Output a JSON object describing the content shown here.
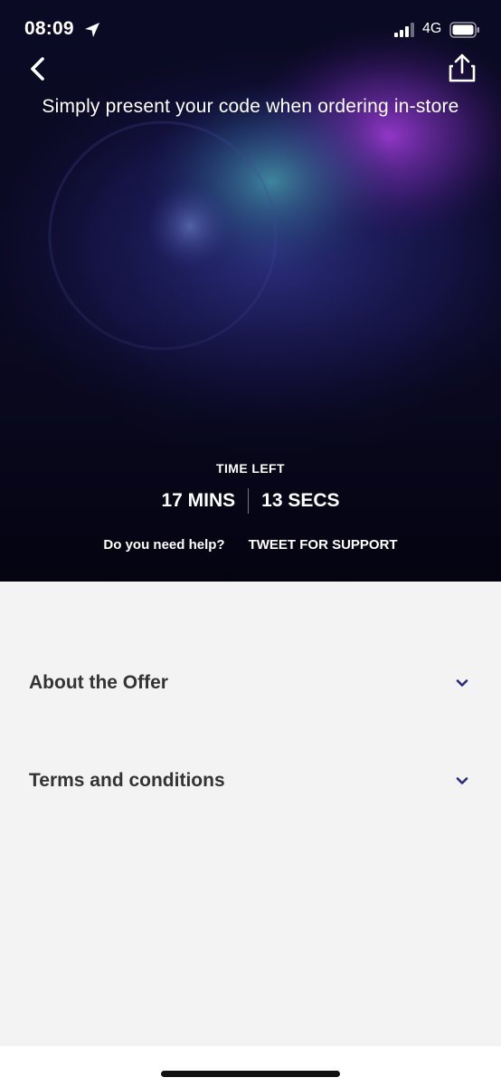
{
  "status_bar": {
    "time": "08:09",
    "network": "4G",
    "icons": [
      "location-arrow-icon",
      "signal-bars-icon",
      "battery-icon"
    ]
  },
  "nav": {
    "back_icon": "chevron-left-icon",
    "share_icon": "share-icon"
  },
  "hero": {
    "instruction": "Simply present your code when ordering in-store",
    "time_left_label": "TIME LEFT",
    "timer": {
      "mins": "17 MINS",
      "secs": "13 SECS"
    },
    "help_text": "Do you need help?",
    "support_link": "TWEET FOR SUPPORT"
  },
  "accordion": [
    {
      "label": "Terms and conditions",
      "icon": "chevron-down-icon"
    },
    {
      "label": "About the Offer",
      "icon": "chevron-down-icon"
    }
  ],
  "colors": {
    "hero_base": "#0a0820",
    "accent_purple": "#9b33d6",
    "accent_teal": "#3a8fb0",
    "chevron": "#2b2a85",
    "panel_bg": "#f3f3f4",
    "text_dark": "#333333"
  }
}
